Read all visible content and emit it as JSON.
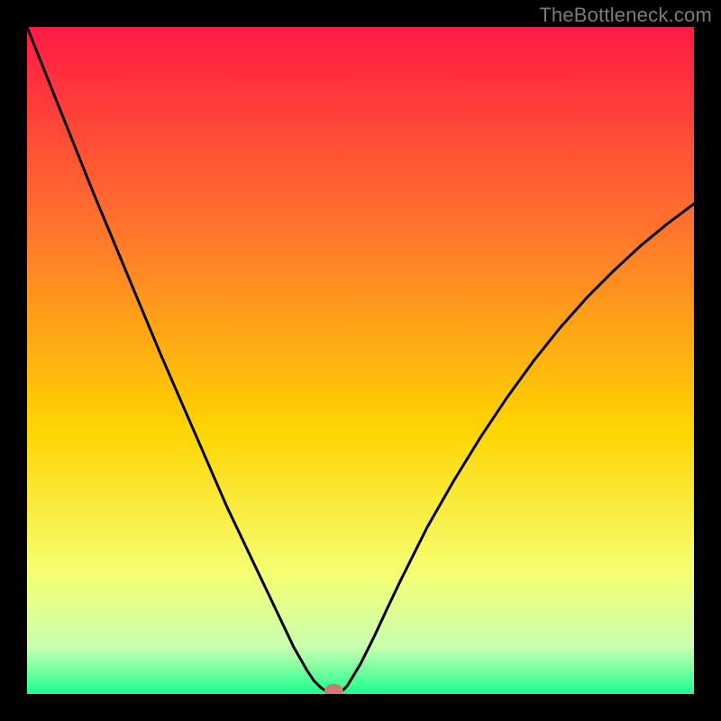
{
  "watermark": {
    "text": "TheBottleneck.com"
  },
  "colors": {
    "frame": "#000000",
    "gradient_top": "#ff1a44",
    "gradient_mid1": "#ff7a2a",
    "gradient_mid2": "#ffd400",
    "gradient_mid3": "#f5ff73",
    "gradient_mid4": "#c9ffb0",
    "gradient_bottom": "#1cff8f",
    "curve": "#000000",
    "marker_fill": "#ce7b74",
    "marker_stroke": "#ce7b74"
  },
  "chart_data": {
    "type": "line",
    "title": "",
    "xlabel": "",
    "ylabel": "",
    "xlim": [
      0,
      100
    ],
    "ylim": [
      0,
      100
    ],
    "grid": false,
    "legend": "none",
    "annotations": [],
    "background": "vertical-gradient red→orange→yellow→green",
    "x": [
      0,
      2,
      4,
      6,
      8,
      10,
      12,
      14,
      16,
      18,
      20,
      22,
      24,
      26,
      28,
      30,
      32,
      34,
      36,
      38,
      40,
      42,
      43,
      44,
      45,
      46,
      47,
      48,
      50,
      52,
      54,
      56,
      58,
      60,
      64,
      68,
      72,
      76,
      80,
      84,
      88,
      92,
      96,
      100
    ],
    "values": [
      100.0,
      95.0,
      90.0,
      85.0,
      80.0,
      75.0,
      70.2,
      65.4,
      60.6,
      55.8,
      51.0,
      46.4,
      41.8,
      37.2,
      32.6,
      28.0,
      23.8,
      19.6,
      15.4,
      11.2,
      7.0,
      3.5,
      2.0,
      1.0,
      0.3,
      0.0,
      0.2,
      1.2,
      4.5,
      8.5,
      12.8,
      17.0,
      21.0,
      25.0,
      32.0,
      38.5,
      44.5,
      50.0,
      55.0,
      59.5,
      63.5,
      67.2,
      70.5,
      73.5
    ],
    "marker": {
      "x": 46.0,
      "y": 0.5
    }
  }
}
